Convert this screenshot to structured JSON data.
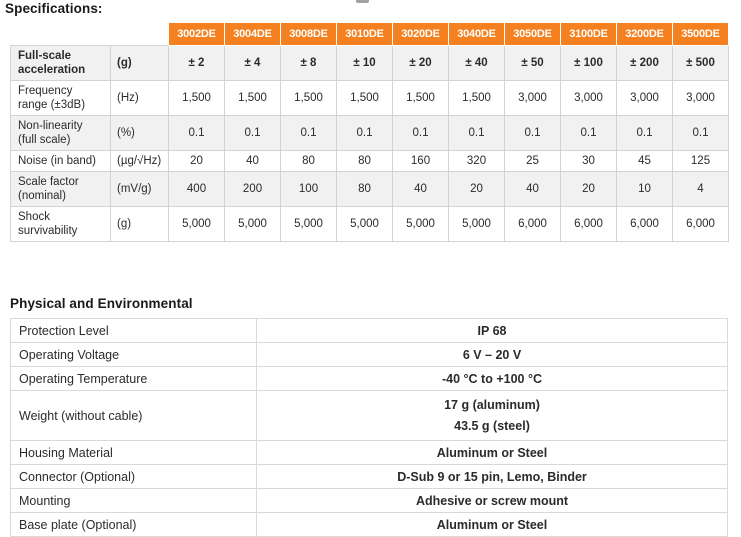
{
  "specs": {
    "heading": "Specifications:",
    "models": [
      "3002DE",
      "3004DE",
      "3008DE",
      "3010DE",
      "3020DE",
      "3040DE",
      "3050DE",
      "3100DE",
      "3200DE",
      "3500DE"
    ],
    "rows": [
      {
        "param": "Full-scale acceleration",
        "unit": "(g)",
        "values": [
          "± 2",
          "± 4",
          "± 8",
          "± 10",
          "± 20",
          "± 40",
          "± 50",
          "± 100",
          "± 200",
          "± 500"
        ]
      },
      {
        "param": "Frequency range (±3dB)",
        "unit": "(Hz)",
        "values": [
          "1,500",
          "1,500",
          "1,500",
          "1,500",
          "1,500",
          "1,500",
          "3,000",
          "3,000",
          "3,000",
          "3,000"
        ]
      },
      {
        "param": "Non-linearity (full scale)",
        "unit": "(%)",
        "values": [
          "0.1",
          "0.1",
          "0.1",
          "0.1",
          "0.1",
          "0.1",
          "0.1",
          "0.1",
          "0.1",
          "0.1"
        ]
      },
      {
        "param": "Noise (in band)",
        "unit": "(µg/√Hz)",
        "values": [
          "20",
          "40",
          "80",
          "80",
          "160",
          "320",
          "25",
          "30",
          "45",
          "125"
        ]
      },
      {
        "param": "Scale factor (nominal)",
        "unit": "(mV/g)",
        "values": [
          "400",
          "200",
          "100",
          "80",
          "40",
          "20",
          "40",
          "20",
          "10",
          "4"
        ]
      },
      {
        "param": "Shock survivability",
        "unit": "(g)",
        "values": [
          "5,000",
          "5,000",
          "5,000",
          "5,000",
          "5,000",
          "5,000",
          "6,000",
          "6,000",
          "6,000",
          "6,000"
        ]
      }
    ]
  },
  "physical": {
    "heading": "Physical and Environmental",
    "rows": [
      {
        "label": "Protection Level",
        "value": "IP 68"
      },
      {
        "label": "Operating Voltage",
        "value": "6 V – 20 V"
      },
      {
        "label": "Operating Temperature",
        "value": "-40 °C to +100 °C"
      },
      {
        "label": "Weight (without cable)",
        "value_line1": "17 g (aluminum)",
        "value_line2": "43.5 g (steel)"
      },
      {
        "label": "Housing Material",
        "value": "Aluminum or Steel"
      },
      {
        "label": "Connector (Optional)",
        "value": "D-Sub 9 or 15 pin, Lemo, Binder"
      },
      {
        "label": "Mounting",
        "value": "Adhesive or screw mount"
      },
      {
        "label": "Base plate (Optional)",
        "value": "Aluminum or Steel"
      }
    ]
  },
  "colors": {
    "header_orange": "#f5801f",
    "row_shade": "#f1f1f1",
    "border": "#d3d3d3"
  }
}
